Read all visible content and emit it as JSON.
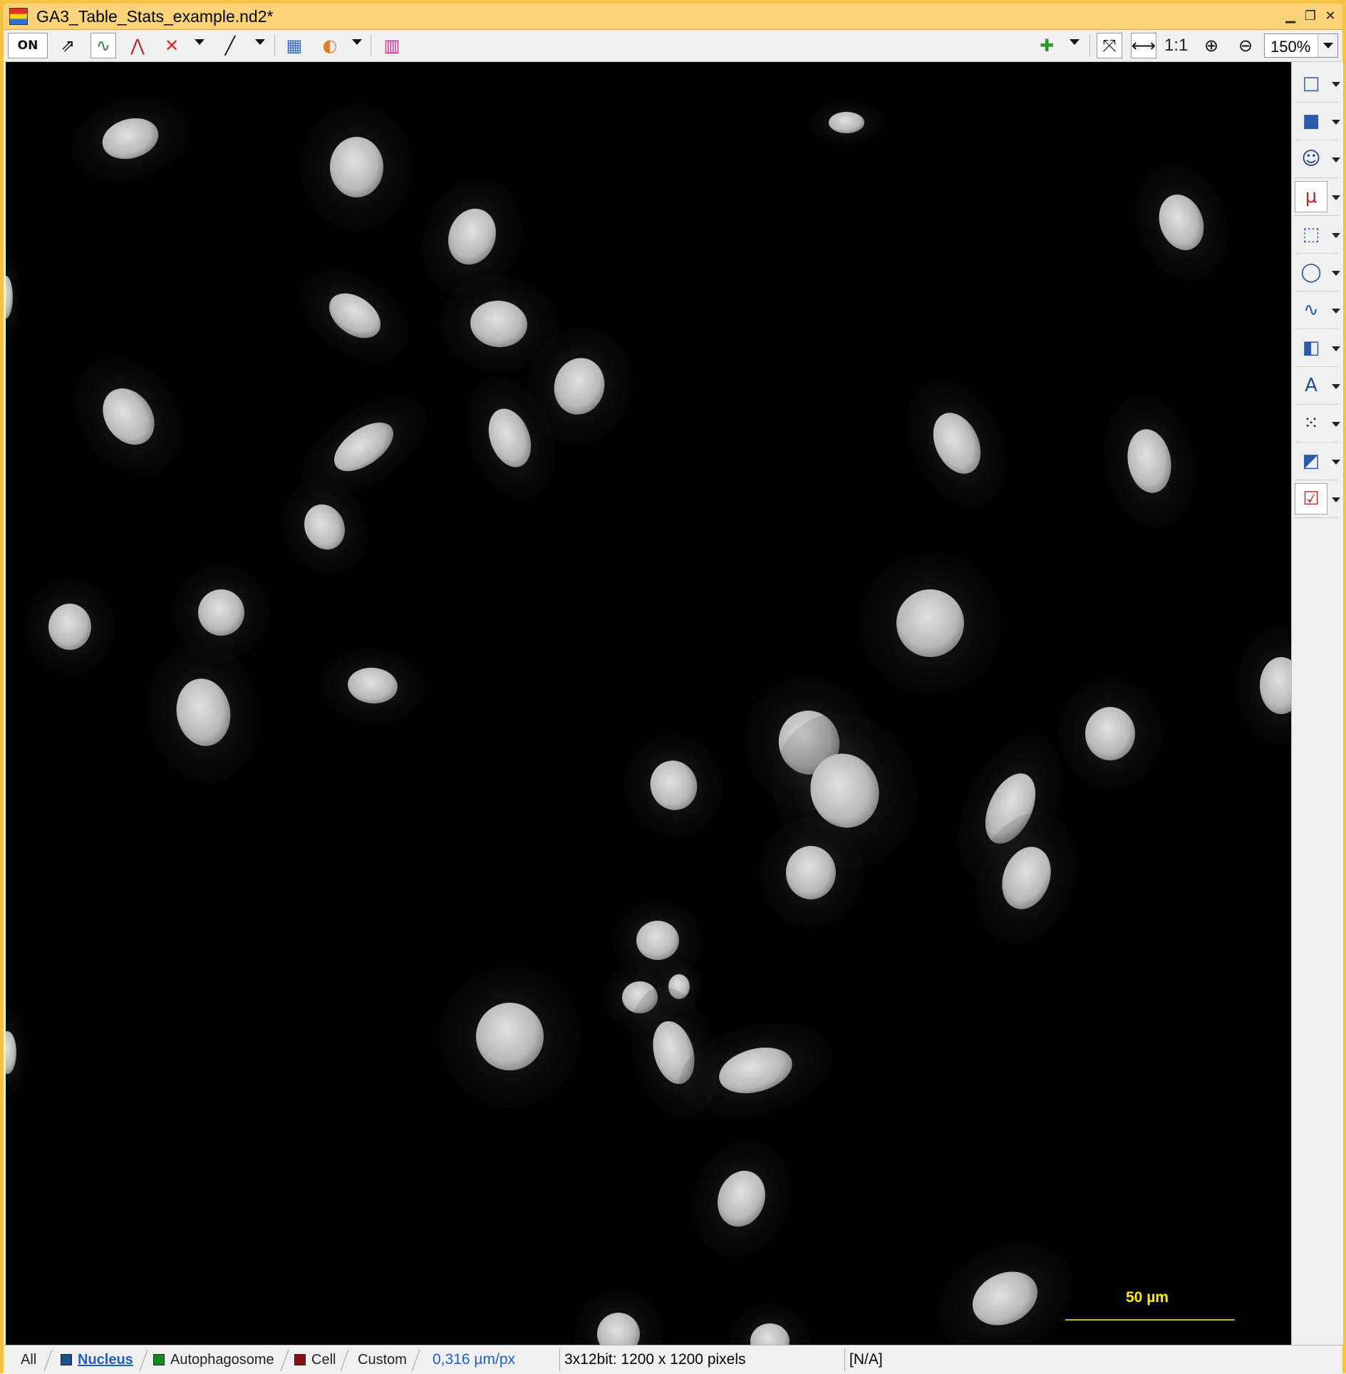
{
  "window": {
    "title": "GA3_Table_Stats_example.nd2*",
    "minimize_glyph": "▁",
    "maximize_glyph": "❐",
    "close_glyph": "✕"
  },
  "toolbar": {
    "buttons": [
      {
        "name": "lut-on-toggle-icon",
        "glyph": "ON",
        "active": true
      },
      {
        "name": "auto-scale-icon",
        "glyph": "⇗"
      },
      {
        "name": "live-histogram-icon",
        "glyph": "∿",
        "active": true
      },
      {
        "name": "curve-icon",
        "glyph": "⋀"
      },
      {
        "name": "reset-lut-icon",
        "glyph": "✕"
      },
      {
        "name": "gamma-icon",
        "glyph": "╱"
      },
      {
        "name": "channel-layout-icon",
        "glyph": "▦"
      },
      {
        "name": "color-blend-icon",
        "glyph": "◐"
      },
      {
        "name": "spectrum-icon",
        "glyph": "▥"
      }
    ],
    "right_buttons": [
      {
        "name": "add-layer-icon",
        "glyph": "✚"
      },
      {
        "name": "fit-to-window-icon",
        "glyph": "⤧"
      },
      {
        "name": "fit-width-icon",
        "glyph": "⟷"
      },
      {
        "name": "zoom-in-icon",
        "glyph": "⊕"
      },
      {
        "name": "zoom-out-icon",
        "glyph": "⊖"
      }
    ],
    "one_to_one_label": "1:1",
    "zoom_value": "150%"
  },
  "right_panel": {
    "tools": [
      {
        "name": "rectangle-outline-icon",
        "glyph": "□"
      },
      {
        "name": "rectangle-filled-icon",
        "glyph": "■"
      },
      {
        "name": "mask-icon",
        "glyph": "☺"
      },
      {
        "name": "measure-length-icon",
        "glyph": "μ",
        "active": true
      },
      {
        "name": "crop-icon",
        "glyph": "⬚"
      },
      {
        "name": "roi-ellipse-icon",
        "glyph": "◯"
      },
      {
        "name": "intensity-profile-icon",
        "glyph": "∿"
      },
      {
        "name": "bookmark-icon",
        "glyph": "◧"
      },
      {
        "name": "text-annotation-icon",
        "glyph": "A"
      },
      {
        "name": "object-count-icon",
        "glyph": "⁙"
      },
      {
        "name": "binary-icon",
        "glyph": "◩"
      },
      {
        "name": "checklist-icon",
        "glyph": "☑",
        "active": true
      }
    ]
  },
  "image": {
    "scalebar_label": "50 µm"
  },
  "statusbar": {
    "tabs": [
      {
        "label": "All",
        "swatch": ""
      },
      {
        "label": "Nucleus",
        "swatch": "#1a4f8a",
        "active": true
      },
      {
        "label": "Autophagosome",
        "swatch": "#0f8a1e"
      },
      {
        "label": "Cell",
        "swatch": "#8a0e0e"
      },
      {
        "label": "Custom",
        "swatch": ""
      }
    ],
    "calibration": "0,316 µm/px",
    "image_info": "3x12bit: 1200 x 1200 pixels",
    "value_readout": "[N/A]"
  },
  "colors": {
    "title_bar": "#f9d27a",
    "frame": "#f5c242",
    "scalebar": "#ffee00",
    "calibration_text": "#1f5fbf"
  }
}
